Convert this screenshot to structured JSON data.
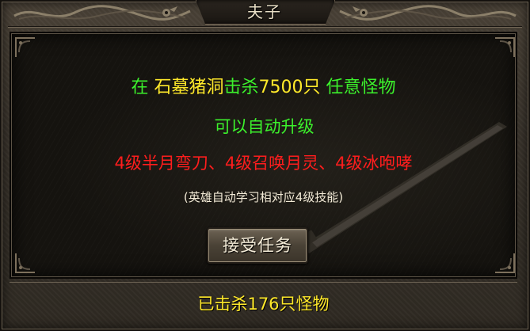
{
  "window": {
    "title": "夫子"
  },
  "quest": {
    "line1": {
      "prefix": "在",
      "location": "石墓猪洞",
      "action": "击杀",
      "amount": "7500只",
      "target": "任意怪物"
    },
    "line2": "可以自动升级",
    "line3": "4级半月弯刀、4级召唤月灵、4级冰咆哮",
    "line4": "(英雄自动学习相对应4级技能)",
    "accept_label": "接受任务",
    "progress_text": "已击杀176只怪物"
  },
  "colors": {
    "green": "#3cf12c",
    "yellow": "#ffe92a",
    "red": "#ff1d1d",
    "white": "#f2ead6"
  },
  "icons": [
    "dragon-ornament-icon",
    "corner-ornament-icon",
    "sword-background-icon"
  ]
}
